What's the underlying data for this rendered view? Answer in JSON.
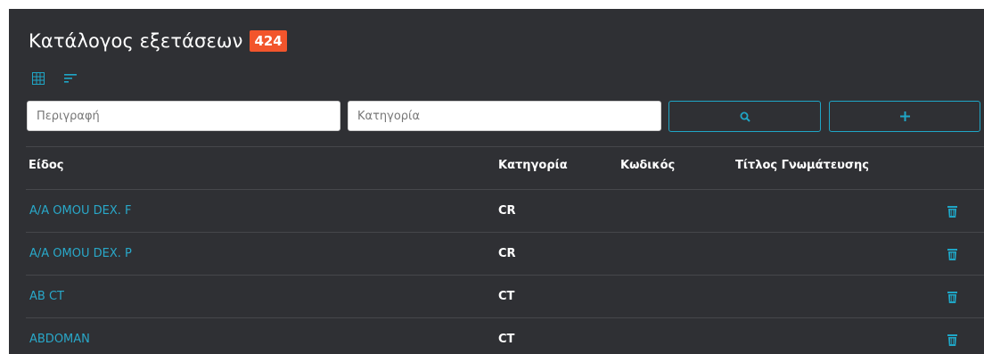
{
  "header": {
    "title": "Κατάλογος εξετάσεων",
    "count": "424"
  },
  "toolbar": {
    "grid_icon": "grid-view-icon",
    "sort_icon": "sort-lines-icon"
  },
  "filters": {
    "description_placeholder": "Περιγραφή",
    "category_placeholder": "Κατηγορία",
    "search_icon": "search-icon",
    "add_icon": "plus-icon"
  },
  "table": {
    "columns": [
      "Είδος",
      "Κατηγορία",
      "Κωδικός",
      "Τίτλος Γνωμάτευσης"
    ],
    "rows": [
      {
        "name": "A/A OMOU DEX. F",
        "category": "CR",
        "code": "",
        "title": ""
      },
      {
        "name": "A/A OMOU DEX. P",
        "category": "CR",
        "code": "",
        "title": ""
      },
      {
        "name": "AB CT",
        "category": "CT",
        "code": "",
        "title": ""
      },
      {
        "name": "ABDOMAN",
        "category": "CT",
        "code": "",
        "title": ""
      }
    ],
    "row_action_icon": "trash-icon"
  },
  "colors": {
    "background": "#2f3034",
    "accent": "#1fa6c6",
    "badge": "#f2552c",
    "link": "#29a8c9"
  }
}
